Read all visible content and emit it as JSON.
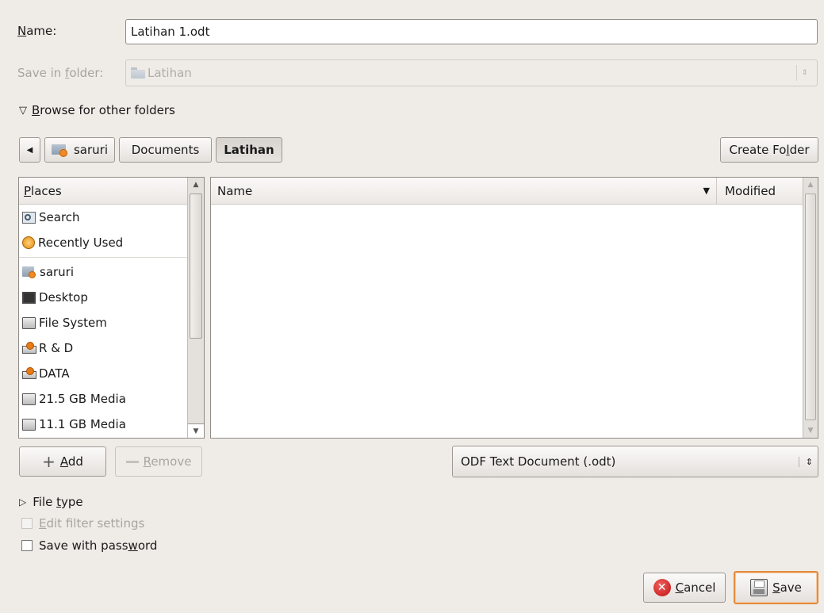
{
  "name_row": {
    "label_prefix": "",
    "label_u": "N",
    "label_rest": "ame:",
    "value": "Latihan 1.odt"
  },
  "save_in": {
    "label_pre": "Save in ",
    "label_u": "f",
    "label_post": "older:",
    "value": "Latihan"
  },
  "browse": {
    "label_u": "B",
    "label_rest": "rowse for other folders"
  },
  "path_bar": {
    "back": "◀",
    "crumbs": [
      "saruri",
      "Documents",
      "Latihan"
    ]
  },
  "create_folder": {
    "pre": "Create Fo",
    "u": "l",
    "post": "der"
  },
  "places": {
    "header_u": "P",
    "header_rest": "laces",
    "items": [
      {
        "label": "Search",
        "icon": "search-icon"
      },
      {
        "label": "Recently Used",
        "icon": "recent-icon"
      },
      {
        "label": "saruri",
        "icon": "home-folder-icon"
      },
      {
        "label": "Desktop",
        "icon": "desktop-icon"
      },
      {
        "label": "File System",
        "icon": "drive-icon"
      },
      {
        "label": "R & D",
        "icon": "network-drive-icon"
      },
      {
        "label": "DATA",
        "icon": "network-drive-icon"
      },
      {
        "label": "21.5 GB Media",
        "icon": "drive-icon"
      },
      {
        "label": "11.1 GB Media",
        "icon": "drive-icon"
      }
    ]
  },
  "files": {
    "col_name": "Name",
    "col_modified": "Modified",
    "sort_indicator": "▼"
  },
  "add_button": {
    "u": "A",
    "rest": "dd"
  },
  "remove_button": {
    "u": "R",
    "rest": "emove"
  },
  "filter": {
    "value": "ODF Text Document (.odt)"
  },
  "file_type": {
    "pre": "File ",
    "u": "t",
    "post": "ype"
  },
  "edit_filter": {
    "u": "E",
    "rest": "dit filter settings",
    "checked": false,
    "disabled": true
  },
  "save_password": {
    "pre": "Save with pass",
    "u": "w",
    "post": "ord",
    "checked": false
  },
  "cancel_button": {
    "u": "C",
    "rest": "ancel"
  },
  "save_button": {
    "u": "S",
    "rest": "ave"
  },
  "colors": {
    "default_button_border": "#e38b3e",
    "window_bg": "#efebe7"
  }
}
